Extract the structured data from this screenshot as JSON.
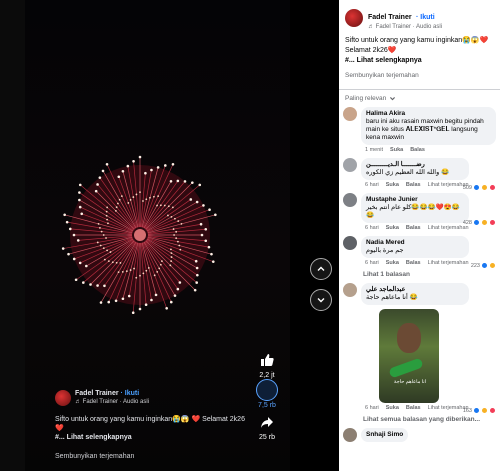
{
  "video": {
    "author": "Fadel Trainer",
    "follow": "· Ikuti",
    "audio": "♬ Fadel Trainer · Audio asli",
    "caption": "Sifto untuk orang yang kamu inginkan😭😱 ❤️ Selamat 2k26❤️",
    "caption_more": "#... Lihat selengkapnya",
    "translate": "Sembunyikan terjemahan",
    "actions": [
      {
        "icon": "thumbs-up-icon",
        "count": "2,2 jt"
      },
      {
        "icon": "comment-icon",
        "count": "7,5 rb"
      },
      {
        "icon": "share-icon",
        "count": "25 rb"
      }
    ]
  },
  "panel": {
    "author": "Fadel Trainer",
    "follow": "· Ikuti",
    "audio": "♬ Fadel Trainer · Audio asli",
    "caption_line1": "Sifto untuk orang yang kamu inginkan😭😱❤️",
    "caption_line2": "Selamat 2k26❤️",
    "caption_more": "#... Lihat selengkapnya",
    "translate": "Sembunyikan terjemahan",
    "sort_label": "Paling relevan"
  },
  "comments": [
    {
      "author": "Halima Akira",
      "text": "baru ini aku rasain maxwin begitu pindah main ke situs 𝐀𝐋𝐄𝐗𝐈𝐒𝐓*𝐆𝐄𝐋 langsung kena maxwin",
      "time": "1 menit",
      "like": "Suka",
      "reply": "Balas",
      "count": ""
    },
    {
      "author": "رضـــــــا الـديـــــــــن",
      "text": "والله الله العظيم زي الكوره 😂",
      "time": "6 hari",
      "like": "Suka",
      "reply": "Balas",
      "translate": "Lihat terjemahan",
      "count": "509"
    },
    {
      "author": "Mustaphe Junier",
      "text": "كلو عام انتم بخير😂😂😂❤️😍😂😂",
      "time": "6 hari",
      "like": "Suka",
      "reply": "Balas",
      "translate": "Lihat terjemahan",
      "count": "428"
    },
    {
      "author": "Nadia Mered",
      "text": "جم مرة باليوم",
      "time": "6 hari",
      "like": "Suka",
      "reply": "Balas",
      "translate": "Lihat terjemahan",
      "count": "223"
    },
    {
      "author": "عبدالماجد علي",
      "text": "أنا ماعاهم حاجة 😂",
      "image_caption": "انا ماعاهم حاجة",
      "time": "6 hari",
      "like": "Suka",
      "reply": "Balas",
      "translate": "Lihat terjemahan",
      "count": "163"
    },
    {
      "author": "Snhaji Simo",
      "text": "",
      "time": "",
      "like": "",
      "reply": "",
      "count": ""
    }
  ],
  "replies": {
    "nadia": "Lihat 1 balasan",
    "abdul": "Lihat semua balasan yang diberikan..."
  }
}
